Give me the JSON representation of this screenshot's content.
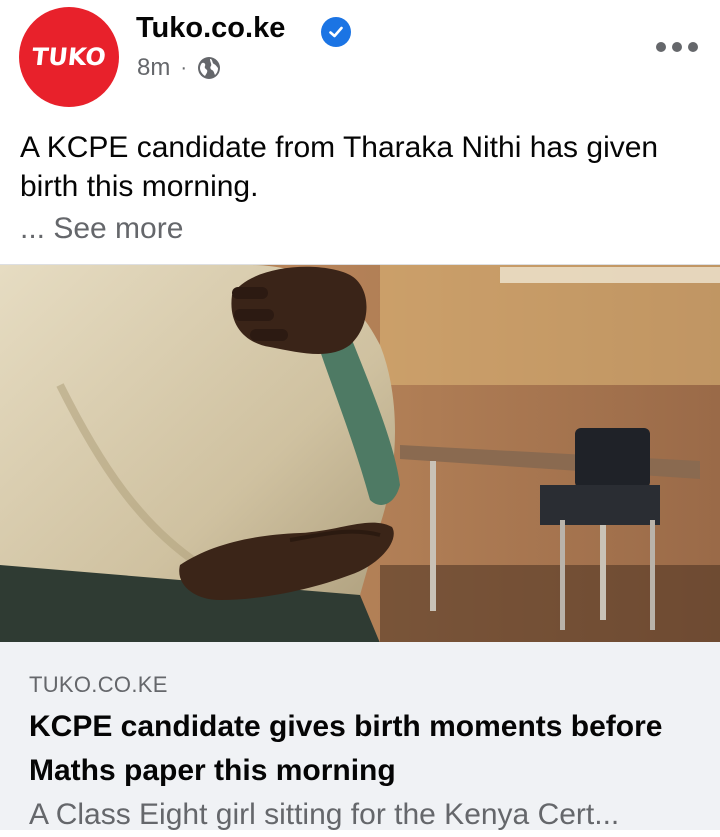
{
  "post": {
    "page_name": "Tuko.co.ke",
    "avatar_text": "TUKO",
    "time": "8m",
    "separator": "·",
    "text": "A KCPE candidate from Tharaka Nithi has given birth this morning.",
    "see_more": "... See more"
  },
  "link_preview": {
    "domain": "TUKO.CO.KE",
    "title": "KCPE candidate gives birth moments before Maths paper this morning",
    "description": "A Class Eight girl sitting for the Kenya Cert..."
  },
  "icons": {
    "verified": "verified-badge-icon",
    "audience": "globe-icon",
    "menu": "more-options-icon"
  },
  "colors": {
    "brand_red": "#e8212b",
    "verified_blue": "#1b74e4",
    "secondary_text": "#65676b",
    "link_bg": "#f0f2f5"
  }
}
